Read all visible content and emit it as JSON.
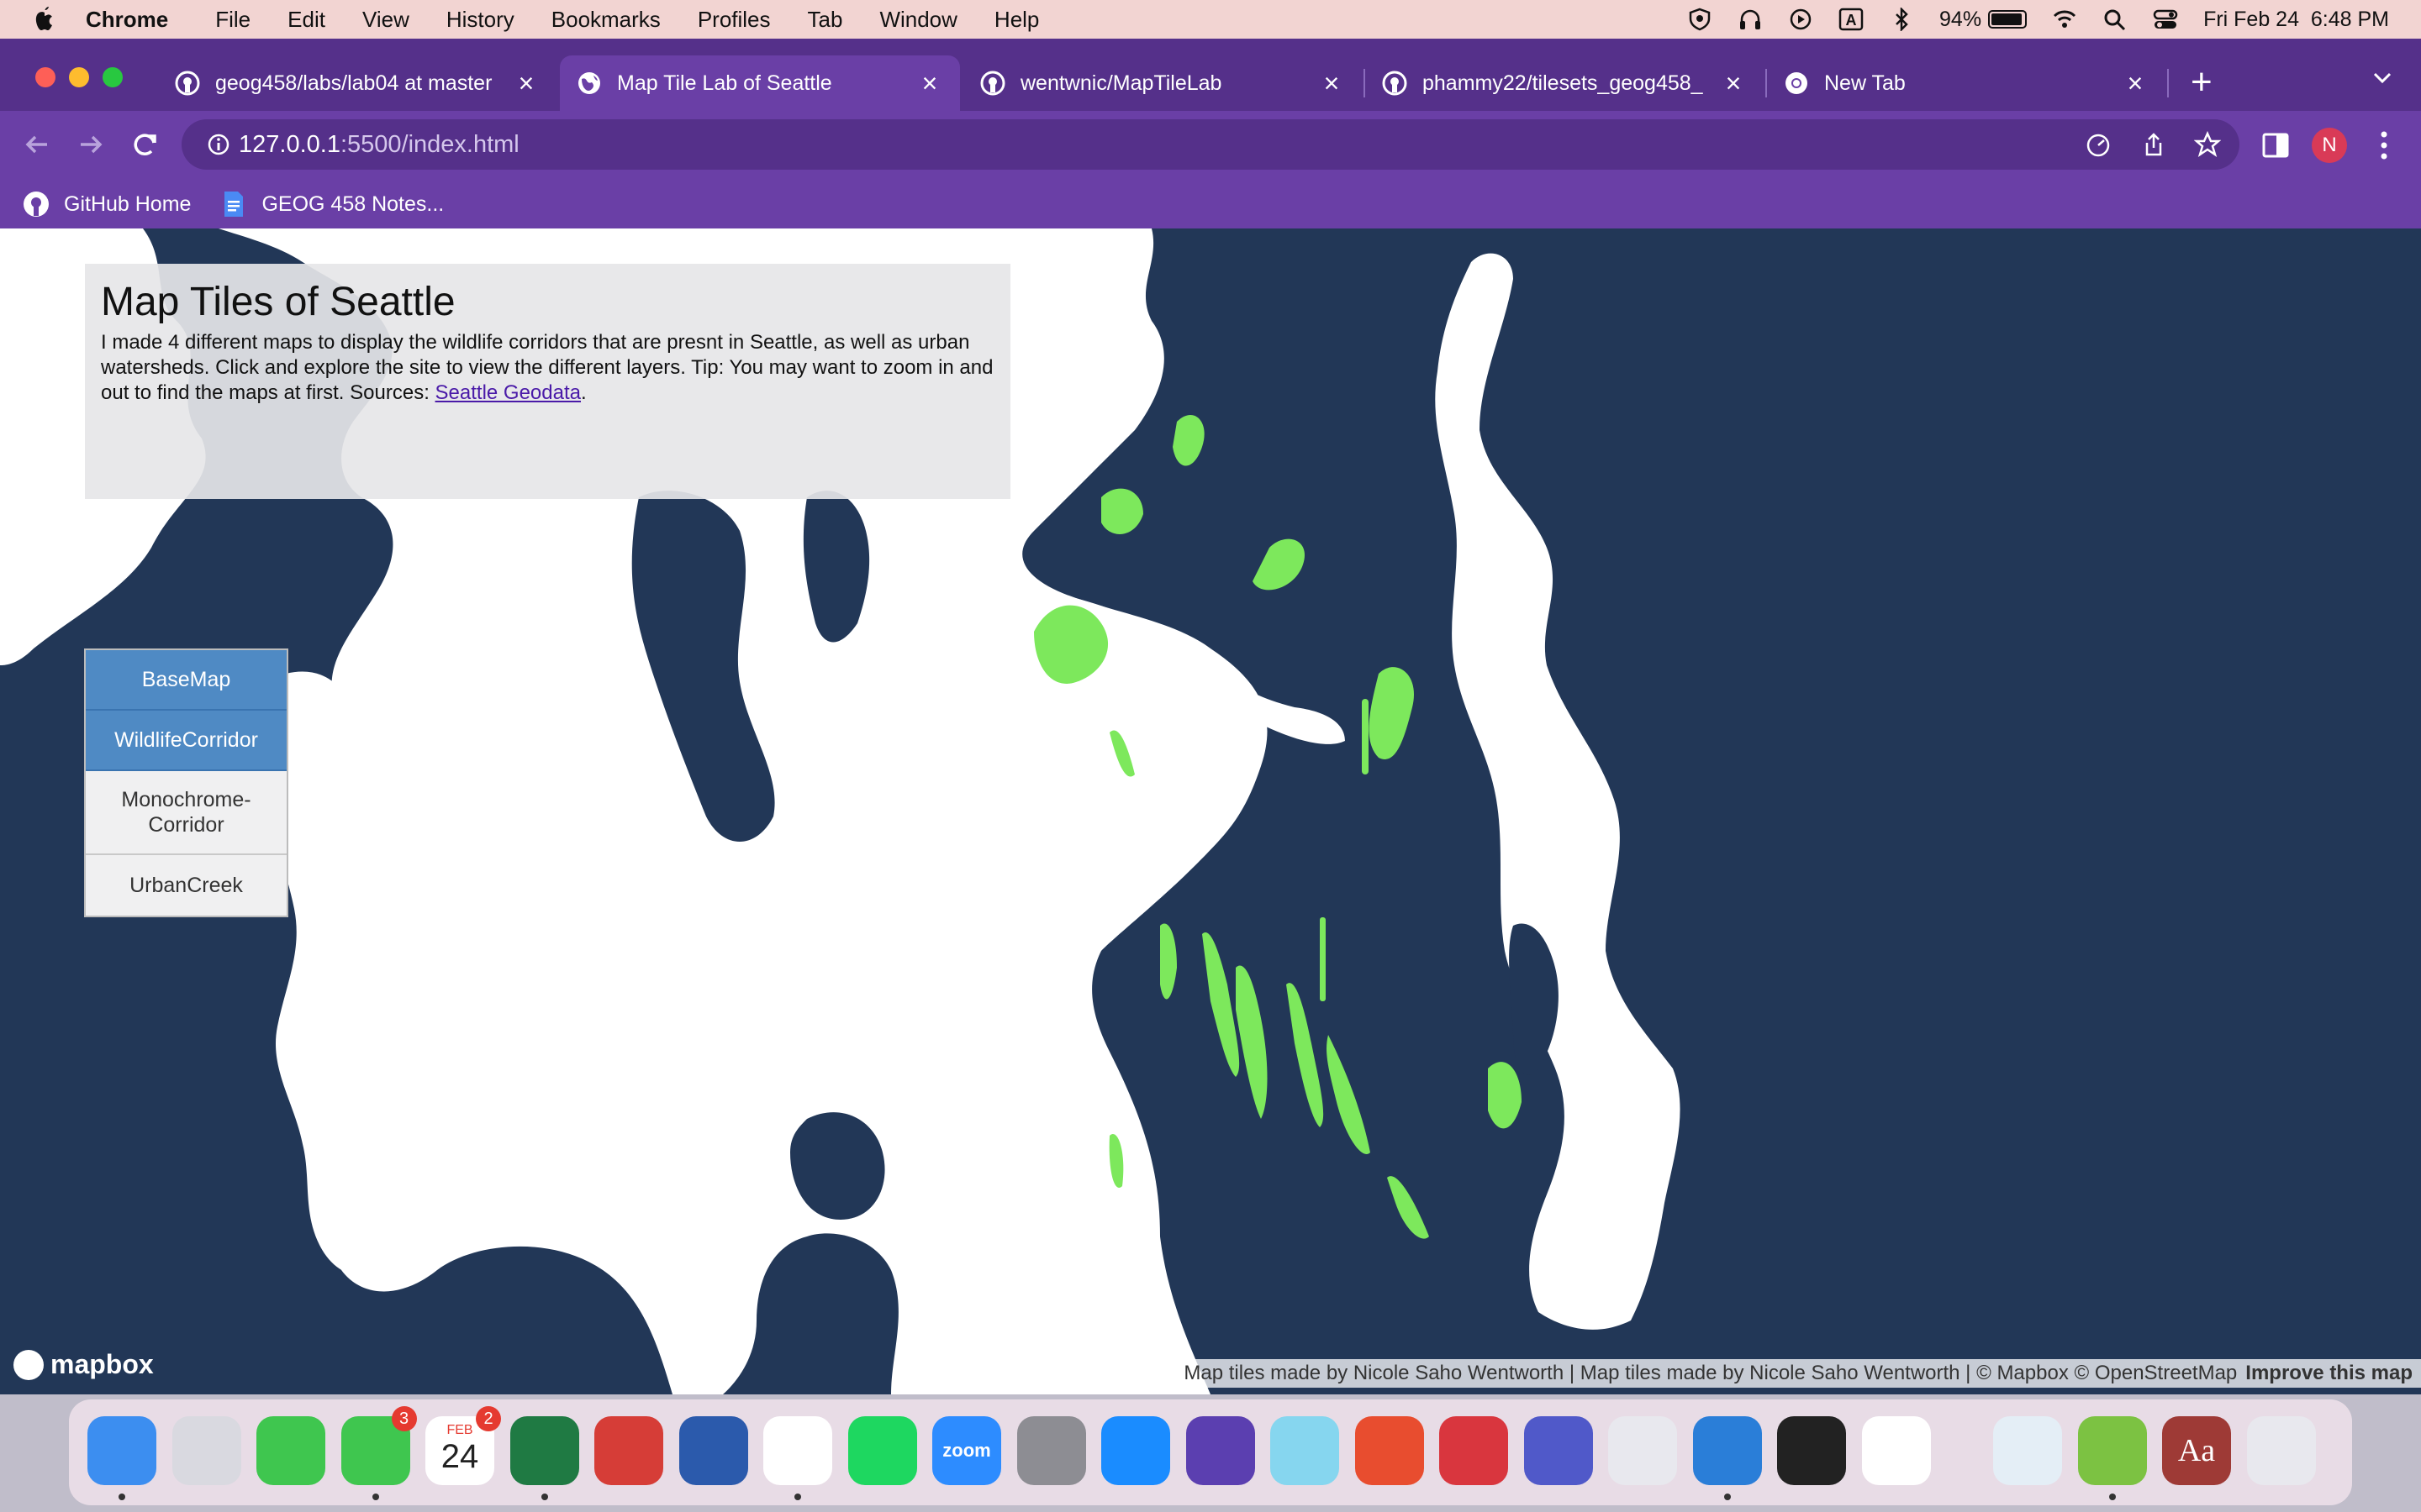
{
  "menubar": {
    "app_name": "Chrome",
    "items": [
      "File",
      "Edit",
      "View",
      "History",
      "Bookmarks",
      "Profiles",
      "Tab",
      "Window",
      "Help"
    ],
    "battery_percent": "94%",
    "battery_level": 0.94,
    "datetime": "Fri Feb 24  6:48 PM",
    "status_icons": [
      "vpn-shield-icon",
      "headphones-icon",
      "play-icon",
      "input-source-icon",
      "bluetooth-icon",
      "battery-icon",
      "wifi-icon",
      "spotlight-search-icon",
      "control-center-icon"
    ],
    "input_source_label": "A"
  },
  "tabs": [
    {
      "title": "geog458/labs/lab04 at master",
      "icon": "github-icon",
      "active": false
    },
    {
      "title": "Map Tile Lab of Seattle",
      "icon": "globe-icon",
      "active": true
    },
    {
      "title": "wentwnic/MapTileLab",
      "icon": "github-icon",
      "active": false
    },
    {
      "title": "phammy22/tilesets_geog458_",
      "icon": "github-icon",
      "active": false
    },
    {
      "title": "New Tab",
      "icon": "chrome-icon",
      "active": false
    }
  ],
  "address": {
    "host": "127.0.0.1",
    "rest": ":5500/index.html"
  },
  "profile_initial": "N",
  "bookmarks": [
    {
      "label": "GitHub Home",
      "icon": "github-icon"
    },
    {
      "label": "GEOG 458 Notes...",
      "icon": "google-docs-icon"
    }
  ],
  "page": {
    "title": "Map Tiles of Seattle",
    "description": "I made 4 different maps to display the wildlife corridors that are presnt in Seattle, as well as urban watersheds. Click and explore the site to view the different layers. Tip: You may want to zoom in and out to find the maps at first. Sources: ",
    "source_link": "Seattle Geodata",
    "trailing": ".",
    "layers": [
      {
        "label": "BaseMap",
        "active": true
      },
      {
        "label": "WildlifeCorridor",
        "active": true
      },
      {
        "label": "Monochrome-Corridor",
        "active": false
      },
      {
        "label": "UrbanCreek",
        "active": false
      }
    ],
    "mapbox_logo": "mapbox",
    "attribution": "Map tiles made by Nicole Saho Wentworth | Map tiles made by Nicole Saho Wentworth | © Mapbox © OpenStreetMap",
    "improve_link": "Improve this map"
  },
  "colors": {
    "water": "#223757",
    "land": "#ffffff",
    "corridor": "#7de85c",
    "active_layer": "#4f8ac4",
    "tabstrip": "#55308a",
    "toolbar": "#6a3fa6"
  },
  "dock": {
    "apps": [
      "finder-icon",
      "launchpad-icon",
      "facetime-icon",
      "messages-icon",
      "calendar-icon",
      "excel-icon",
      "photo-booth-icon",
      "word-icon",
      "chrome-icon",
      "spotify-icon",
      "zoom-icon",
      "system-preferences-icon",
      "app-store-icon",
      "imovie-icon",
      "game-icon",
      "remote-desktop-icon",
      "security-icon",
      "teams-icon",
      "help-icon",
      "vscode-icon",
      "terminal-icon",
      "freeform-icon",
      "preview-icon",
      "qgis-icon",
      "dictionary-icon",
      "trash-icon"
    ],
    "messages_badge": "3",
    "calendar_badge": "2",
    "calendar_month": "FEB",
    "calendar_day": "24",
    "zoom_label": "zoom",
    "dictionary_label": "Aa"
  }
}
